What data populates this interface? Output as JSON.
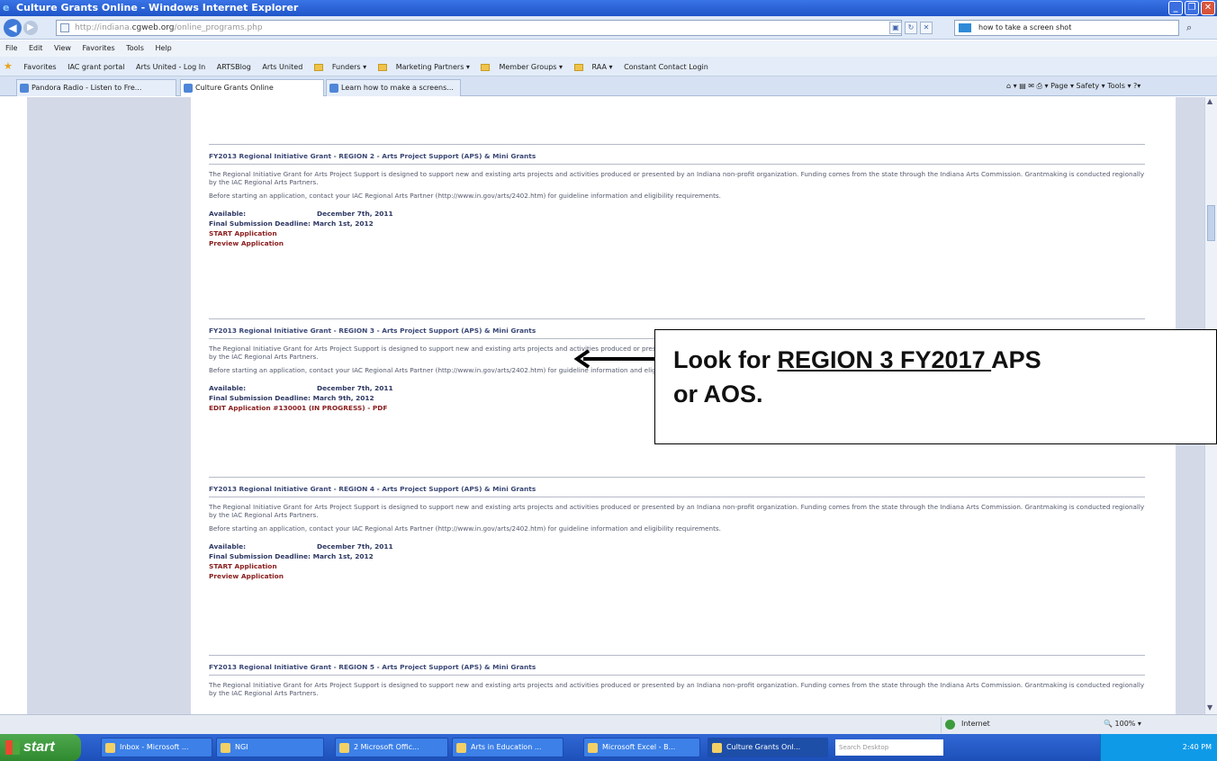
{
  "window": {
    "title": "Culture Grants Online - Windows Internet Explorer"
  },
  "address": {
    "prefix": "http://indiana.",
    "domain": "cgweb.org",
    "suffix": "/online_programs.php"
  },
  "search": {
    "value": "how to take a screen shot"
  },
  "menu": [
    "File",
    "Edit",
    "View",
    "Favorites",
    "Tools",
    "Help"
  ],
  "favorites": [
    "Favorites",
    "IAC grant portal",
    "Arts United - Log In",
    "ARTSBlog",
    "Arts United",
    "Funders ▾",
    "Marketing Partners ▾",
    "Member Groups ▾",
    "RAA ▾",
    "Constant Contact Login"
  ],
  "tabs": [
    "Pandora Radio - Listen to Fre...",
    "Culture Grants Online",
    "Learn how to make a screens..."
  ],
  "tab_tools": "Page ▾  Safety ▾  Tools ▾",
  "grants": [
    {
      "title": "FY2013 Regional Initiative Grant - REGION 2 - Arts Project Support (APS) & Mini Grants",
      "desc": "The Regional Initiative Grant for Arts Project Support is designed to support new and existing arts projects and activities produced or presented by an Indiana non-profit organization. Funding comes from the state through the Indiana Arts Commission. Grantmaking is conducted regionally by the IAC Regional Arts Partners.",
      "before": "Before starting an application, contact your IAC Regional Arts Partner (http://www.in.gov/arts/2402.htm) for guideline information and eligibility requirements.",
      "available_label": "Available:",
      "available": "December 7th, 2011",
      "deadline_label": "Final Submission Deadline:",
      "deadline": "March 1st, 2012",
      "links": [
        "START Application",
        "Preview Application"
      ]
    },
    {
      "title": "FY2013 Regional Initiative Grant - REGION 3 - Arts Project Support (APS) & Mini Grants",
      "desc": "The Regional Initiative Grant for Arts Project Support is designed to support new and existing arts projects and activities produced or presented by an Indiana non-profit organization. Funding comes from the state through the Indiana Arts Commission. Grantmaking is conducted regionally by the IAC Regional Arts Partners.",
      "before": "Before starting an application, contact your IAC Regional Arts Partner (http://www.in.gov/arts/2402.htm) for guideline information and eligibility requirements.",
      "available_label": "Available:",
      "available": "December 7th, 2011",
      "deadline_label": "Final Submission Deadline:",
      "deadline": "March 9th, 2012",
      "links": [
        "EDIT Application #130001 (IN PROGRESS) - PDF"
      ]
    },
    {
      "title": "FY2013 Regional Initiative Grant - REGION 4 - Arts Project Support (APS) & Mini Grants",
      "desc": "The Regional Initiative Grant for Arts Project Support is designed to support new and existing arts projects and activities produced or presented by an Indiana non-profit organization. Funding comes from the state through the Indiana Arts Commission. Grantmaking is conducted regionally by the IAC Regional Arts Partners.",
      "before": "Before starting an application, contact your IAC Regional Arts Partner (http://www.in.gov/arts/2402.htm) for guideline information and eligibility requirements.",
      "available_label": "Available:",
      "available": "December 7th, 2011",
      "deadline_label": "Final Submission Deadline:",
      "deadline": "March 1st, 2012",
      "links": [
        "START Application",
        "Preview Application"
      ]
    },
    {
      "title": "FY2013 Regional Initiative Grant - REGION 5 - Arts Project Support (APS) & Mini Grants",
      "desc": "The Regional Initiative Grant for Arts Project Support is designed to support new and existing arts projects and activities produced or presented by an Indiana non-profit organization. Funding comes from the state through the Indiana Arts Commission. Grantmaking is conducted regionally by the IAC Regional Arts Partners."
    }
  ],
  "callout": {
    "pre": "Look for ",
    "underlined": "REGION 3 FY2017 ",
    "post": "APS",
    "line2": "or AOS."
  },
  "status": {
    "zone": "Internet",
    "zoom": "100%"
  },
  "taskbar": {
    "start": "start",
    "items": [
      "Inbox - Microsoft ...",
      "NGI",
      "2 Microsoft Offic...",
      "Arts in Education ...",
      "Microsoft Excel - B...",
      "Culture Grants Onl..."
    ],
    "search_placeholder": "Search Desktop",
    "clock": "2:40 PM"
  }
}
